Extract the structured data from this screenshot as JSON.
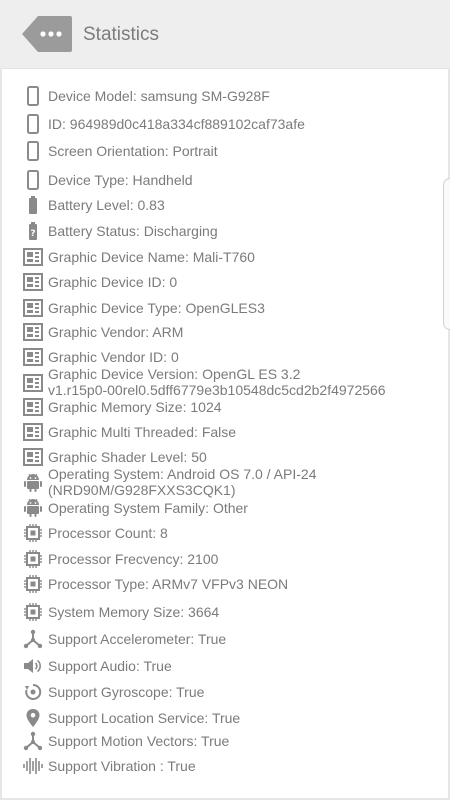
{
  "header": {
    "title": "Statistics"
  },
  "items": [
    {
      "icon": "phone-icon",
      "text": "Device Model: samsung SM-G928F"
    },
    {
      "icon": "phone-icon",
      "text": "ID: 964989d0c418a334cf889102caf73afe"
    },
    {
      "icon": "phone-icon",
      "text": "Screen Orientation: Portrait"
    },
    {
      "icon": "phone-icon",
      "text": "Device Type: Handheld"
    },
    {
      "icon": "battery-icon",
      "text": "Battery Level: 0.83"
    },
    {
      "icon": "battery-unknown-icon",
      "text": "Battery Status: Discharging"
    },
    {
      "icon": "graphics-card-icon",
      "text": "Graphic Device Name: Mali-T760"
    },
    {
      "icon": "graphics-card-icon",
      "text": "Graphic Device ID: 0"
    },
    {
      "icon": "graphics-card-icon",
      "text": "Graphic Device Type: OpenGLES3"
    },
    {
      "icon": "graphics-card-icon",
      "text": "Graphic Vendor: ARM"
    },
    {
      "icon": "graphics-card-icon",
      "text": "Graphic Vendor ID: 0"
    },
    {
      "icon": "graphics-card-icon",
      "text": "Graphic Device Version: OpenGL ES 3.2\nv1.r15p0-00rel0.5dff6779e3b10548dc5cd2b2f4972566"
    },
    {
      "icon": "graphics-card-icon",
      "text": "Graphic Memory Size: 1024"
    },
    {
      "icon": "graphics-card-icon",
      "text": "Graphic Multi Threaded: False"
    },
    {
      "icon": "graphics-card-icon",
      "text": "Graphic Shader Level: 50"
    },
    {
      "icon": "android-icon",
      "text": "Operating System: Android OS 7.0 / API-24\n(NRD90M/G928FXXS3CQK1)"
    },
    {
      "icon": "android-icon",
      "text": "Operating System Family: Other"
    },
    {
      "icon": "processor-icon",
      "text": "Processor Count: 8"
    },
    {
      "icon": "processor-icon",
      "text": "Processor Frecvency: 2100"
    },
    {
      "icon": "processor-icon",
      "text": "Processor Type: ARMv7 VFPv3 NEON"
    },
    {
      "icon": "processor-icon",
      "text": "System Memory Size: 3664"
    },
    {
      "icon": "network-node-icon",
      "text": "Support Accelerometer: True"
    },
    {
      "icon": "speaker-icon",
      "text": "Support Audio: True"
    },
    {
      "icon": "gyroscope-icon",
      "text": "Support Gyroscope: True"
    },
    {
      "icon": "location-pin-icon",
      "text": "Support Location Service: True"
    },
    {
      "icon": "network-node-icon",
      "text": "Support Motion Vectors: True"
    },
    {
      "icon": "vibration-icon",
      "text": "Support Vibration : True"
    }
  ]
}
